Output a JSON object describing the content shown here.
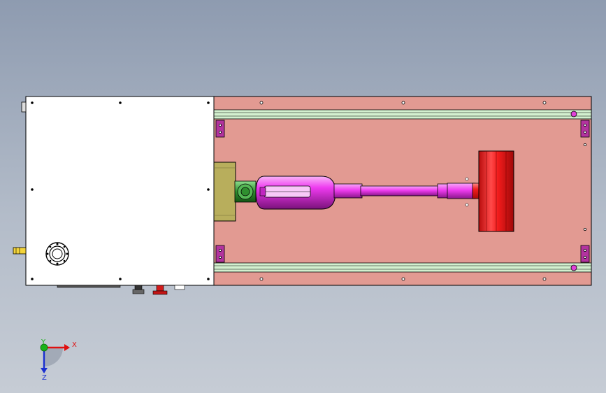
{
  "window": {
    "background_top": "#8e9bb0",
    "background_bottom": "#c6ccd5"
  },
  "model": {
    "colors": {
      "outline": "#000000",
      "control_box": "#ffffff",
      "base_plate": "#e29a92",
      "rail": "#d3f0cf",
      "bracket": "#b3339f",
      "clamp_block": "#b8ae5c",
      "arm": "#ef3cf0",
      "arm_dark": "#9a179a",
      "chuck": "#2f8f2f",
      "nozzle": "#f11c1c",
      "roller": "#f21c1c",
      "yellow_port": "#f3d43a"
    }
  },
  "triad": {
    "x_label": "X",
    "y_label": "Y",
    "z_label": "Z",
    "x_color": "#e01010",
    "y_color": "#19b219",
    "z_color": "#1a2fd0"
  }
}
